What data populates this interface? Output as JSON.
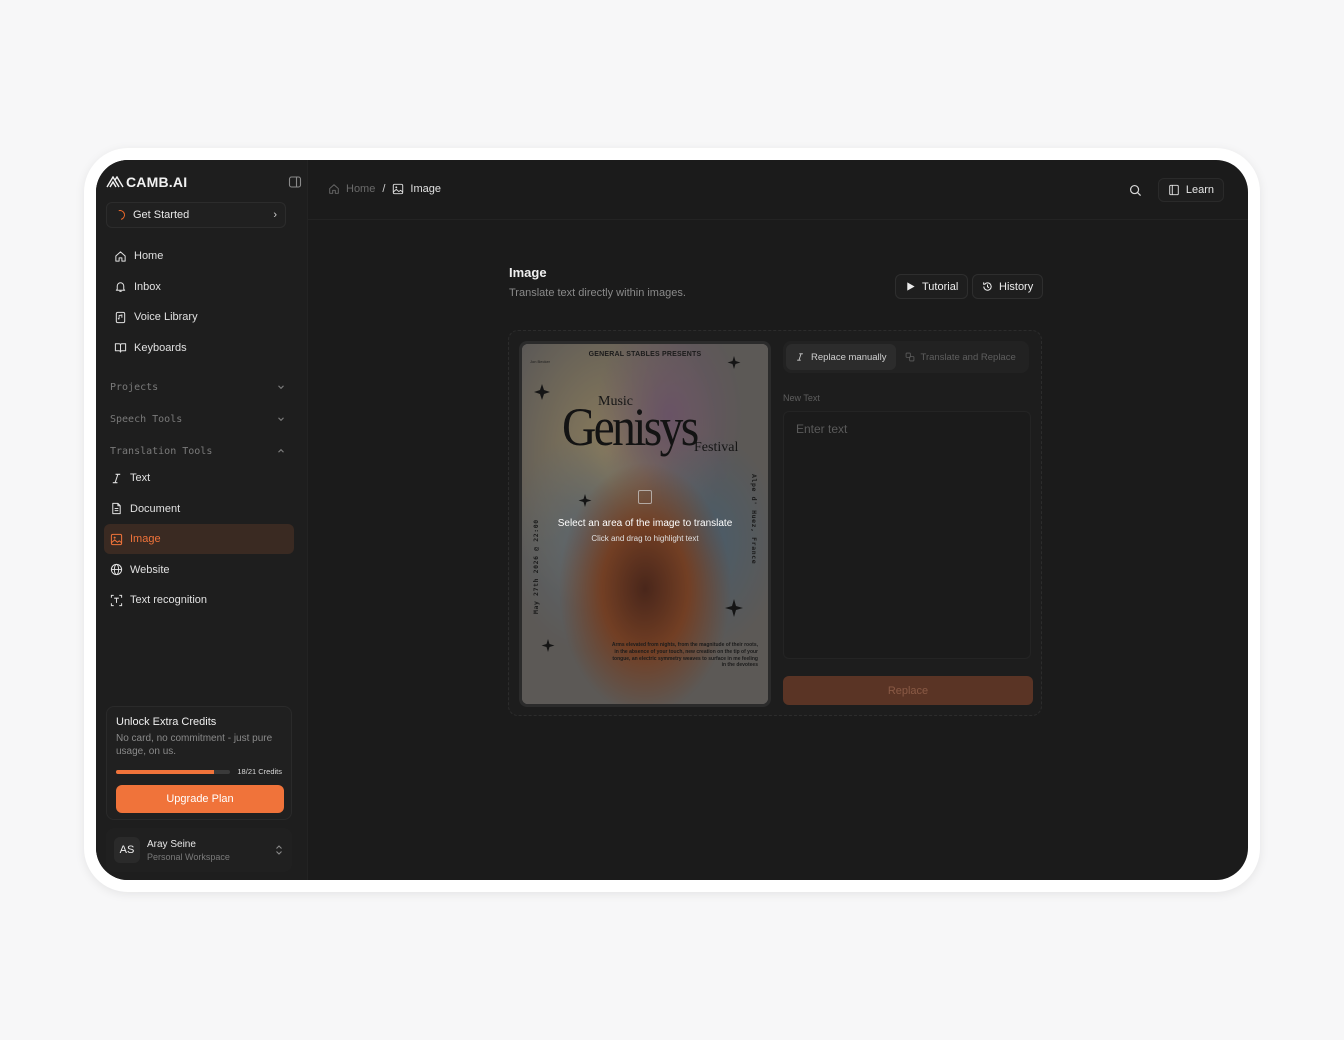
{
  "brand": {
    "name": "CAMB.AI"
  },
  "sidebar": {
    "get_started": "Get Started",
    "nav": [
      {
        "label": "Home",
        "icon": "home-icon"
      },
      {
        "label": "Inbox",
        "icon": "bell-icon"
      },
      {
        "label": "Voice Library",
        "icon": "voice-library-icon"
      },
      {
        "label": "Keyboards",
        "icon": "book-icon"
      }
    ],
    "sections": {
      "projects": "Projects",
      "speech_tools": "Speech Tools",
      "translation_tools": "Translation Tools"
    },
    "translation_items": [
      {
        "label": "Text",
        "icon": "italic-text-icon"
      },
      {
        "label": "Document",
        "icon": "document-icon"
      },
      {
        "label": "Image",
        "icon": "image-icon",
        "active": true
      },
      {
        "label": "Website",
        "icon": "globe-icon"
      },
      {
        "label": "Text recognition",
        "icon": "scan-text-icon"
      }
    ],
    "credits": {
      "title": "Unlock Extra Credits",
      "description": "No card, no commitment - just pure usage, on us.",
      "count": "18/21 Credits",
      "used": 18,
      "total": 21,
      "upgrade": "Upgrade Plan"
    },
    "profile": {
      "initials": "AS",
      "name": "Aray Seine",
      "workspace": "Personal Workspace"
    }
  },
  "topbar": {
    "breadcrumb_home": "Home",
    "breadcrumb_sep": "/",
    "breadcrumb_current": "Image",
    "learn": "Learn"
  },
  "main": {
    "title": "Image",
    "subtitle": "Translate text directly within images.",
    "tutorial": "Tutorial",
    "history": "History",
    "poster": {
      "top": "GENERAL STABLES PRESENTS",
      "tiny": "Jon Becker",
      "music": "Music",
      "name": "Genisys",
      "festival": "Festival",
      "date": "May 27th 2026 @ 22:00",
      "location": "Alpe d' Huez, France",
      "blurb": "Arms elevated from nights, from the magnitude of their roots, in the absence of your touch, new creation on the tip of your tongue, an electric symmetry weaves to surface in me feeling in the devotees"
    },
    "select_hint": {
      "title": "Select an area of the image to translate",
      "subtitle": "Click and drag to highlight text"
    },
    "tabs": {
      "replace_manually": "Replace manually",
      "translate_and_replace": "Translate and Replace"
    },
    "new_text_label": "New Text",
    "text_placeholder": "Enter text",
    "replace": "Replace"
  },
  "colors": {
    "accent": "#f0733a",
    "background": "#1b1b1b",
    "sidebar": "#1e1e1e"
  }
}
